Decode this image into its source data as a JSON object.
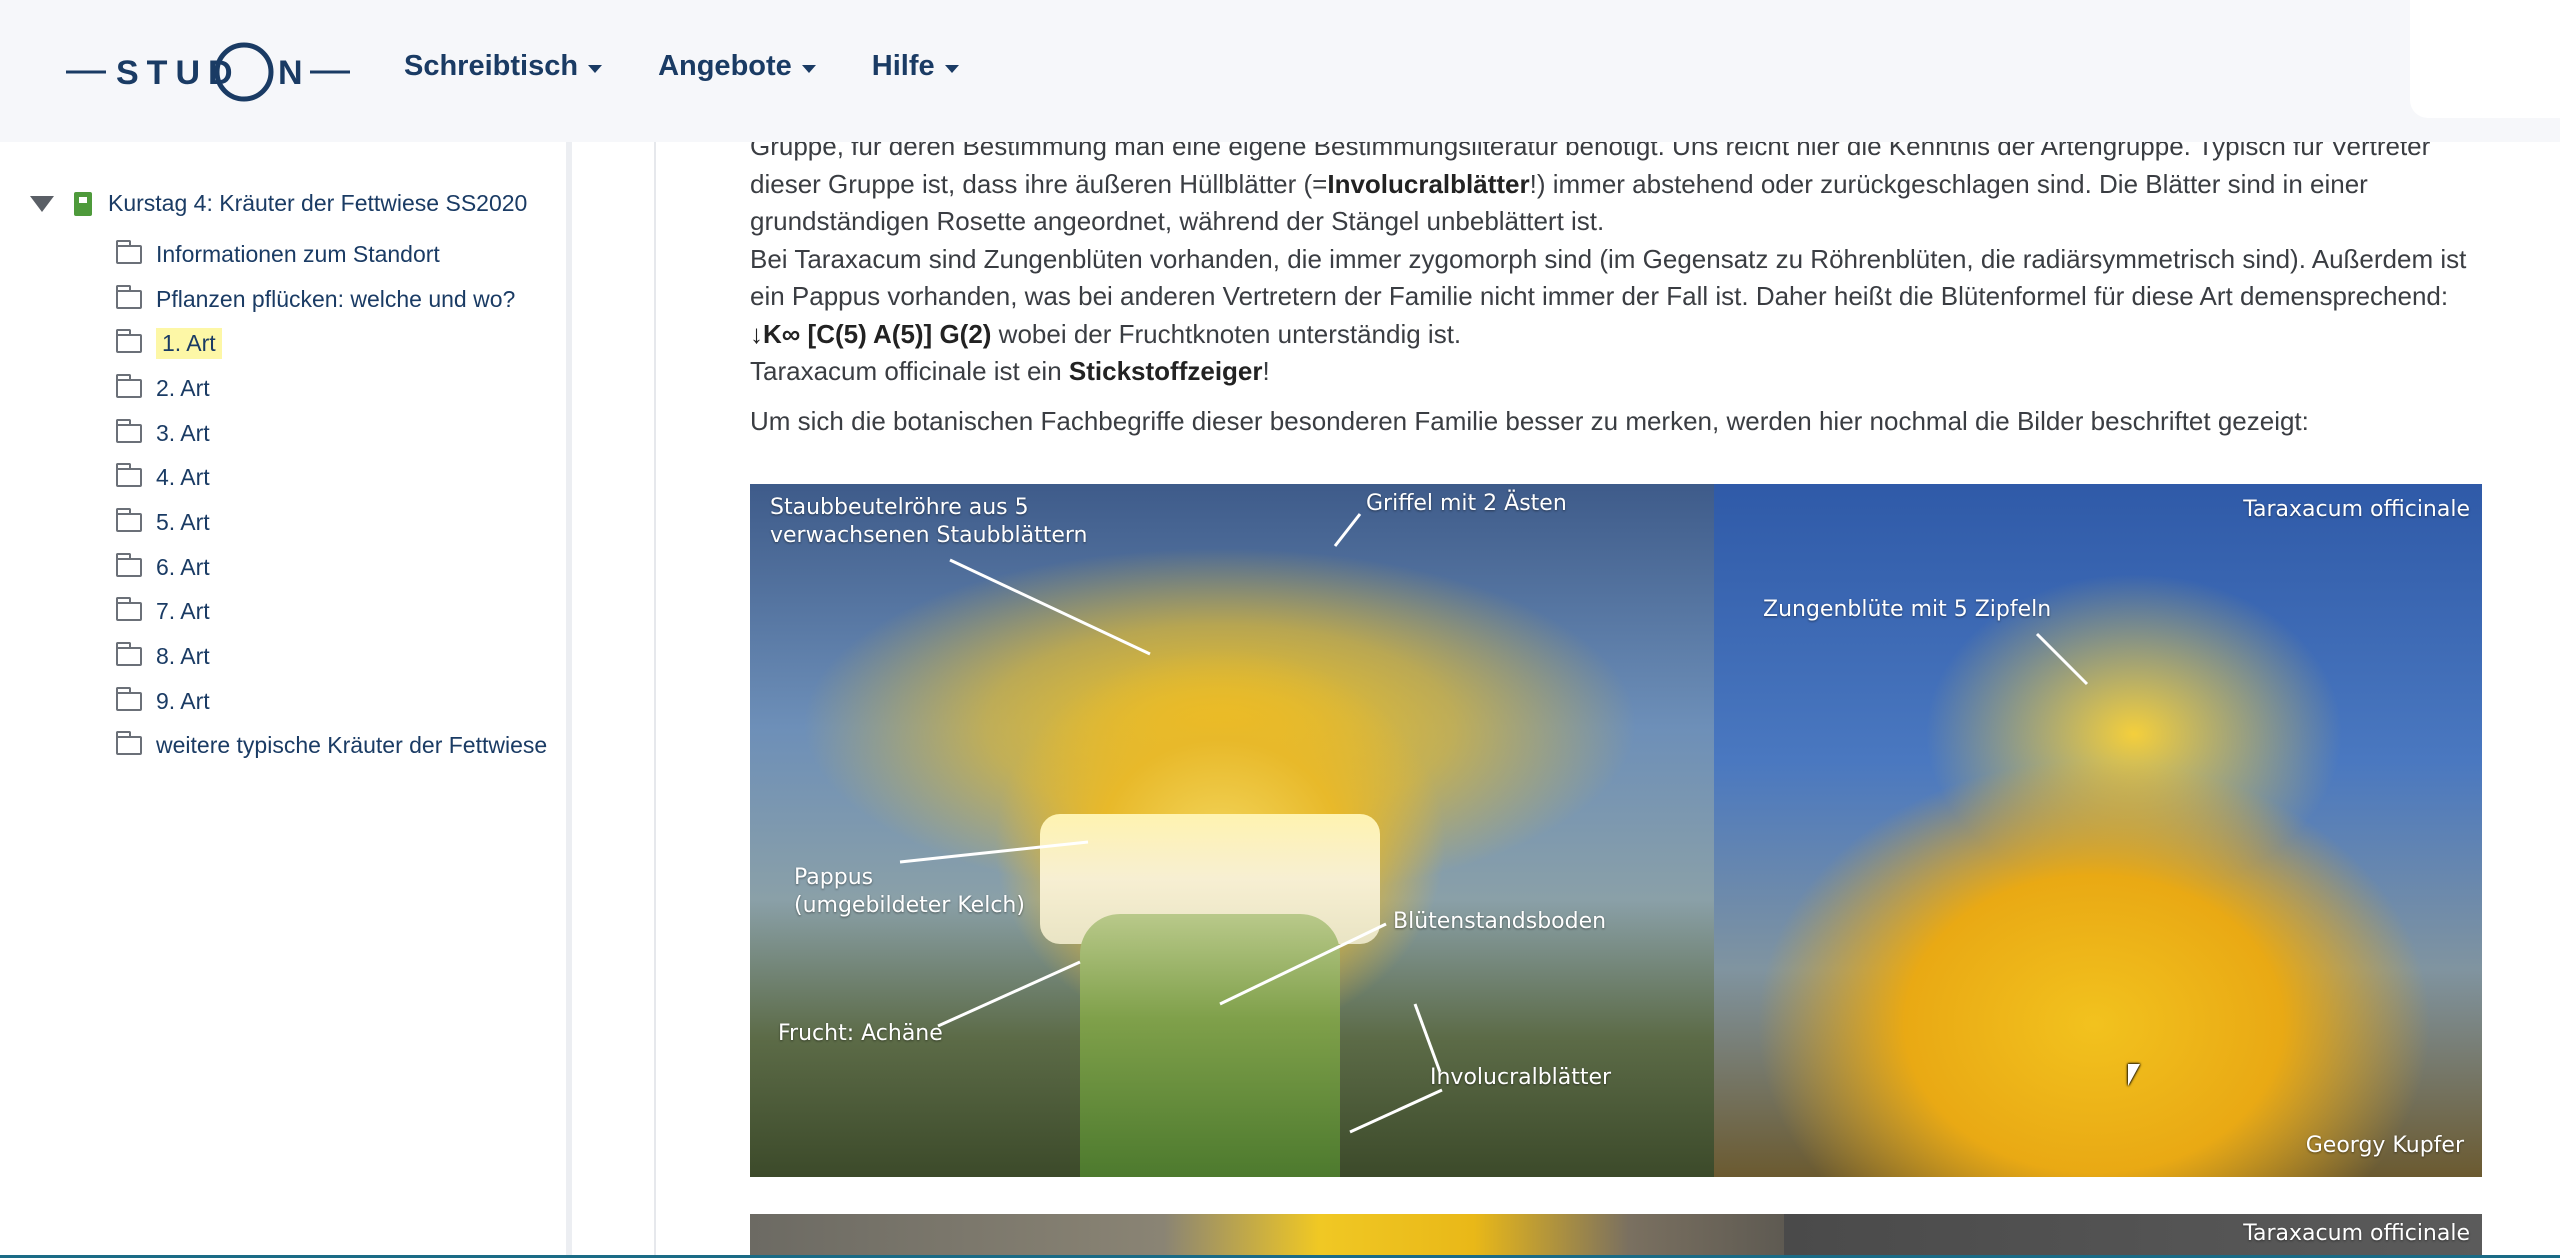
{
  "header": {
    "logo_text": "STUDON",
    "nav": [
      {
        "label": "Schreibtisch"
      },
      {
        "label": "Angebote"
      },
      {
        "label": "Hilfe"
      }
    ]
  },
  "sidebar": {
    "root_label": "Kurstag 4: Kräuter der Fettwiese SS2020",
    "items": [
      {
        "label": "Informationen zum Standort"
      },
      {
        "label": "Pflanzen pflücken: welche und wo?"
      },
      {
        "label": "1. Art",
        "active": true
      },
      {
        "label": "2. Art"
      },
      {
        "label": "3. Art"
      },
      {
        "label": "4. Art"
      },
      {
        "label": "5. Art"
      },
      {
        "label": "6. Art"
      },
      {
        "label": "7. Art"
      },
      {
        "label": "8. Art"
      },
      {
        "label": "9. Art"
      },
      {
        "label": "weitere typische Kräuter der Fettwiese"
      }
    ]
  },
  "content": {
    "line0": "Gruppe, für deren Bestimmung man eine eigene Bestimmungsliteratur benötigt. Uns reicht hier die Kenntnis der Artengruppe. Typisch für Vertreter",
    "line1_a": "dieser Gruppe ist, dass ihre äußeren Hüllblätter (=",
    "line1_b": "Involucralblätter",
    "line1_c": "!) immer abstehend oder zurückgeschlagen sind. Die Blätter sind in einer",
    "line2": "grundständigen Rosette angeordnet, während der Stängel unbeblättert ist.",
    "line3": "Bei Taraxacum sind Zungenblüten vorhanden, die immer zygomorph sind (im Gegensatz zu Röhrenblüten, die radiärsymmetrisch sind). Außerdem ist",
    "line4": "ein Pappus vorhanden, was bei anderen Vertretern der Familie nicht immer der Fall ist. Daher heißt die Blütenformel für diese Art demensprechend:",
    "line5_formula": "↓K∞ [C(5) A(5)] G(2)",
    "line5_rest": " wobei der Fruchtknoten unterständig ist.",
    "line6_a": "Taraxacum officinale ist ein ",
    "line6_b": "Stickstoffzeiger",
    "line6_c": "!",
    "line7": "Um sich die botanischen Fachbegriffe dieser besonderen Familie besser zu merken, werden hier nochmal die Bilder beschriftet gezeigt:"
  },
  "figure": {
    "left_labels": {
      "staubbeutel": "Staubbeutelröhre aus 5\nverwachsenen Staubblättern",
      "griffel": "Griffel mit 2 Ästen",
      "pappus": "Pappus\n(umgebildeter Kelch)",
      "bluetenstandsboden": "Blütenstandsboden",
      "frucht": "Frucht: Achäne",
      "involucral": "Involucralblätter"
    },
    "right_labels": {
      "species": "Taraxacum officinale",
      "zungenbluete": "Zungenblüte mit 5 Zipfeln",
      "author": "Georgy Kupfer"
    }
  },
  "figure2": {
    "species": "Taraxacum officinale"
  }
}
